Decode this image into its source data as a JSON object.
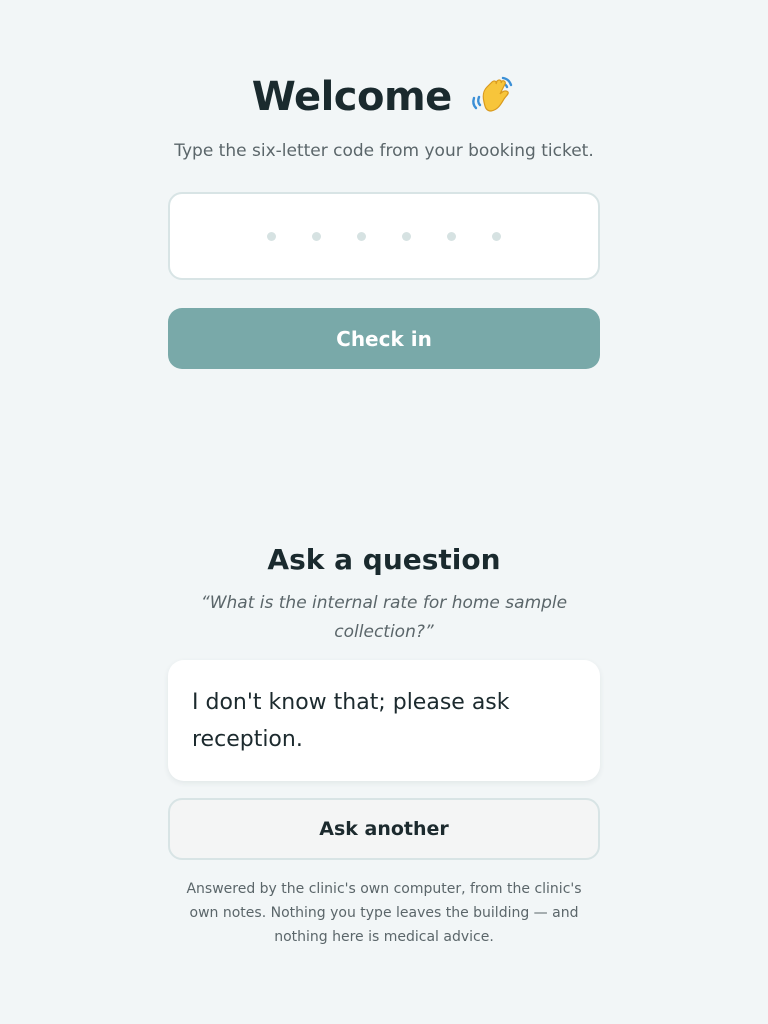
{
  "welcome": {
    "title": "Welcome",
    "emoji": "waving-hand-icon",
    "subtitle": "Type the six-letter code from your booking ticket."
  },
  "code_input": {
    "value": "",
    "slots": 6
  },
  "checkin": {
    "label": "Check in"
  },
  "ask": {
    "title": "Ask a question",
    "question": "“What is the internal rate for home sample collection?”",
    "answer": "I don't know that; please ask reception.",
    "ask_another_label": "Ask another",
    "footnote": "Answered by the clinic's own computer, from the clinic's own notes. Nothing you type leaves the building — and nothing here is medical advice."
  },
  "colors": {
    "background": "#f2f6f7",
    "primary_button": "#79a9a9",
    "text": "#1c2a2e",
    "muted_text": "#5b666a"
  }
}
